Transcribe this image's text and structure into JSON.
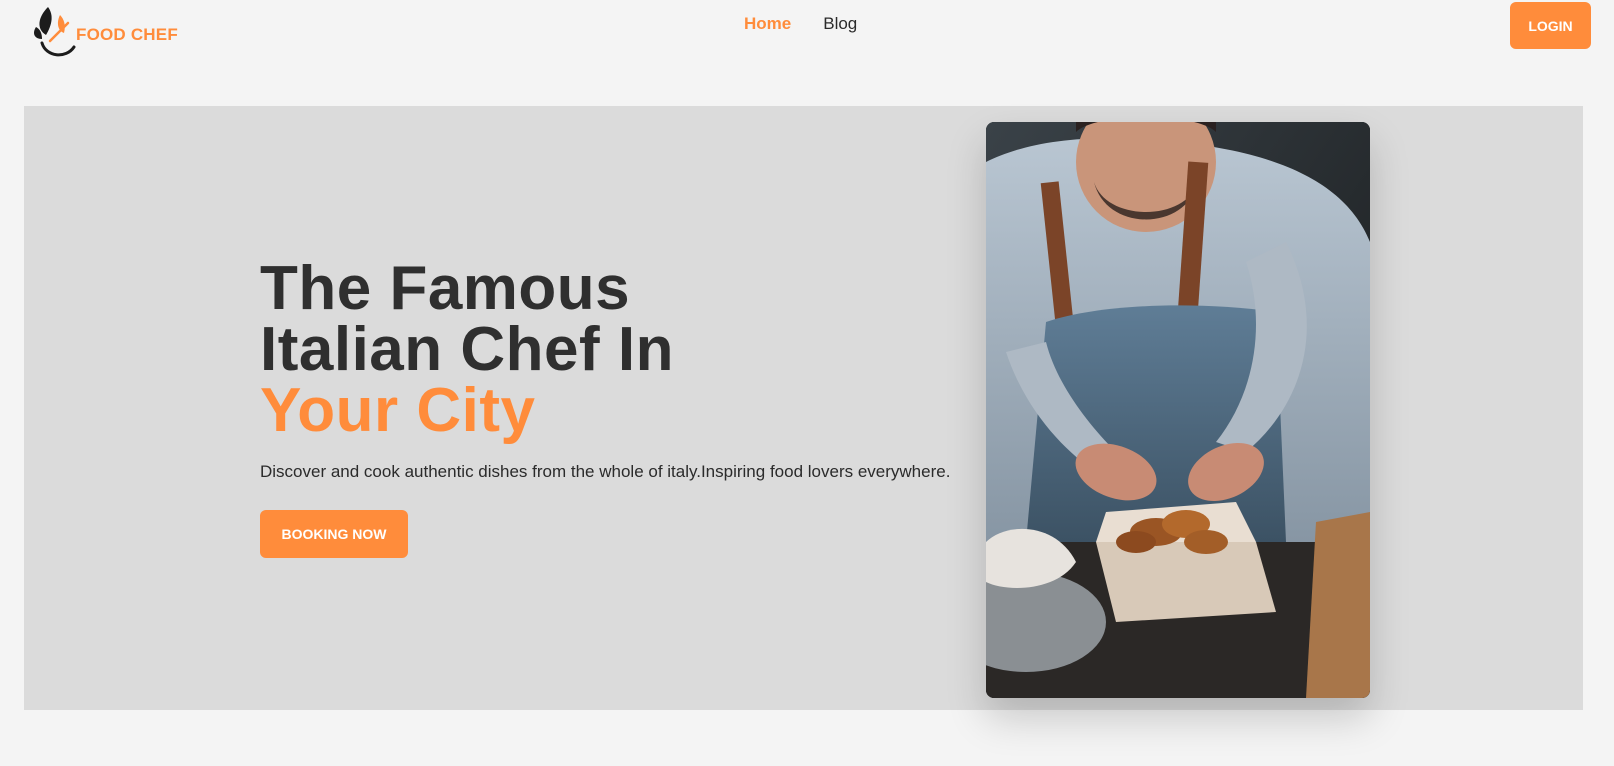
{
  "header": {
    "logo_text": "FOOD CHEF",
    "nav": [
      {
        "label": "Home",
        "active": true
      },
      {
        "label": "Blog",
        "active": false
      }
    ],
    "login_label": "LOGIN"
  },
  "hero": {
    "title_line1": "The Famous",
    "title_line2": "Italian Chef In",
    "title_accent": "Your City",
    "description": "Discover and cook authentic dishes from the whole of italy.Inspiring food lovers everywhere.",
    "cta_label": "BOOKING NOW",
    "image_icon": "chef-photo"
  },
  "colors": {
    "accent": "#ff8c3b",
    "text": "#2f2f2f",
    "hero_bg": "#dbdbdb",
    "page_bg": "#f4f4f4"
  }
}
